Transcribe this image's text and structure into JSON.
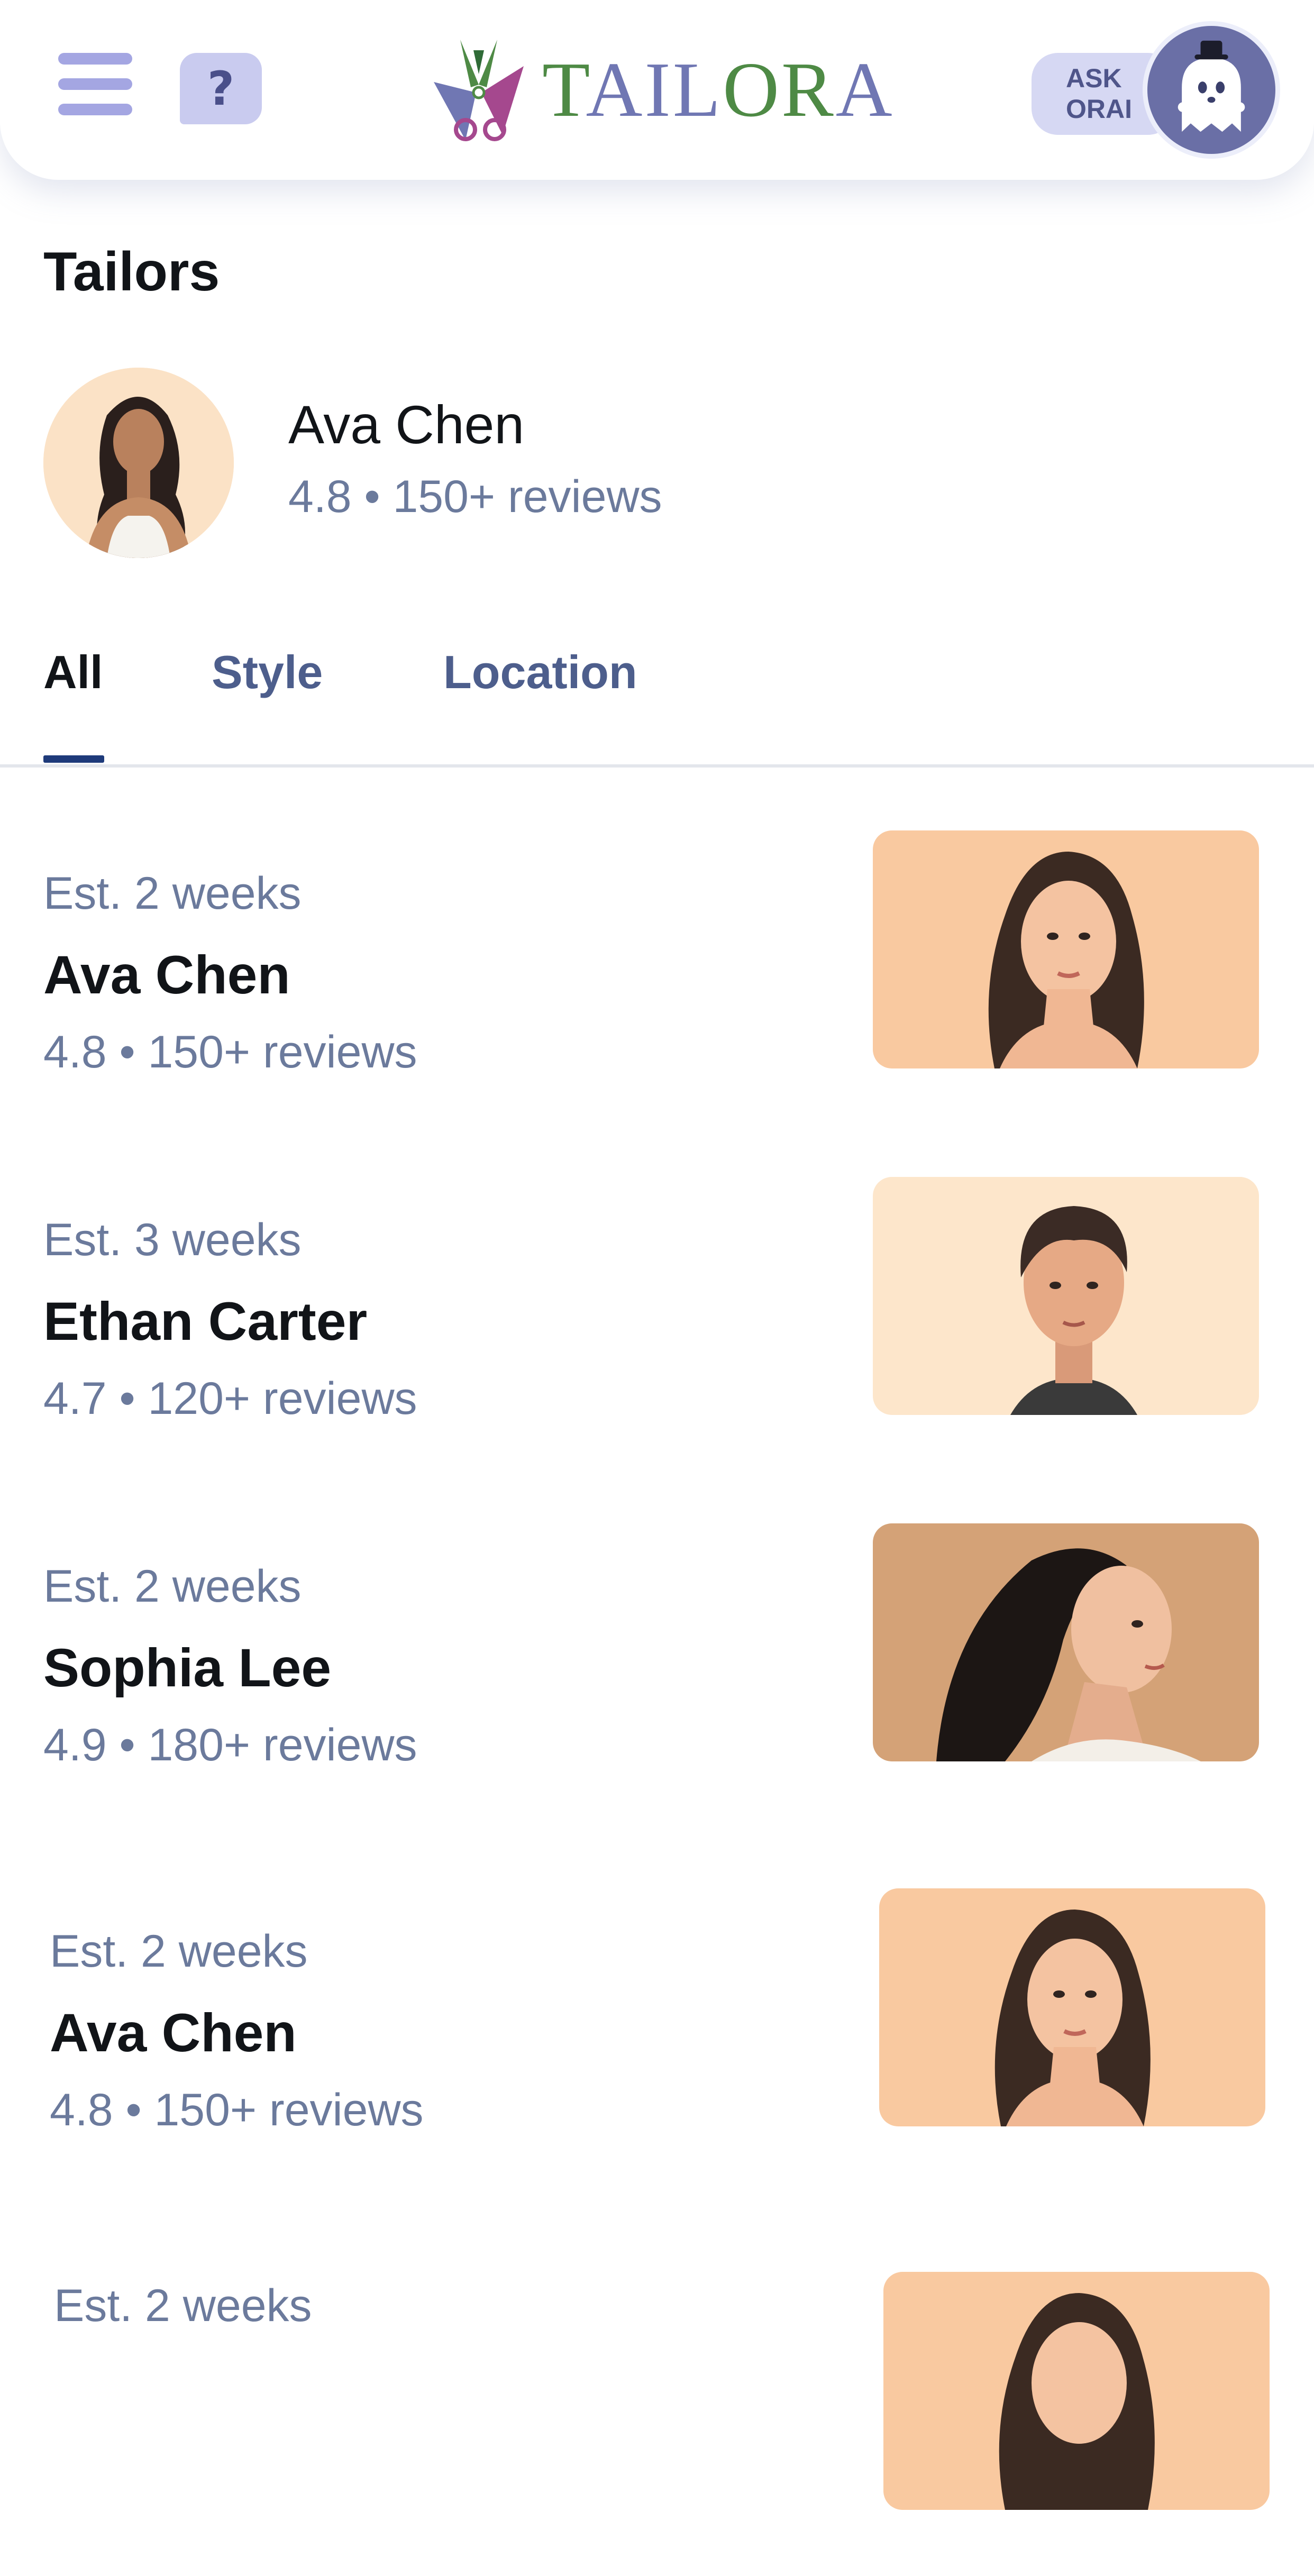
{
  "header": {
    "logo_text": "TAILORA",
    "ask_line1": "ASK",
    "ask_line2": "ORAI",
    "help_label": "?"
  },
  "colors": {
    "brand_green": "#4e8a45",
    "brand_purple": "#7077b3",
    "accent_lavender": "#a4a6e2",
    "tab_active": "#111418",
    "tab_inactive": "#4d5e8c",
    "tab_underline": "#1e3a7a",
    "meta_text": "#6b7a9c"
  },
  "section": {
    "title": "Tailors"
  },
  "featured": {
    "name": "Ava Chen",
    "meta": "4.8 • 150+ reviews"
  },
  "tabs": [
    {
      "label": "All",
      "active": true
    },
    {
      "label": "Style",
      "active": false
    },
    {
      "label": "Location",
      "active": false
    }
  ],
  "tailors": [
    {
      "est": "Est. 2 weeks",
      "name": "Ava Chen",
      "meta": "4.8 • 150+ reviews",
      "portrait": "woman-portrait-icon"
    },
    {
      "est": "Est. 3 weeks",
      "name": "Ethan Carter",
      "meta": "4.7 • 120+ reviews",
      "portrait": "man-portrait-icon"
    },
    {
      "est": "Est. 2 weeks",
      "name": "Sophia Lee",
      "meta": "4.9 • 180+ reviews",
      "portrait": "woman-profile-portrait-icon"
    },
    {
      "est": "Est. 2 weeks",
      "name": "Ava Chen",
      "meta": "4.8 • 150+ reviews",
      "portrait": "woman-portrait-icon"
    },
    {
      "est": "Est. 2 weeks",
      "name": "",
      "meta": "",
      "portrait": "woman-portrait-icon"
    }
  ]
}
